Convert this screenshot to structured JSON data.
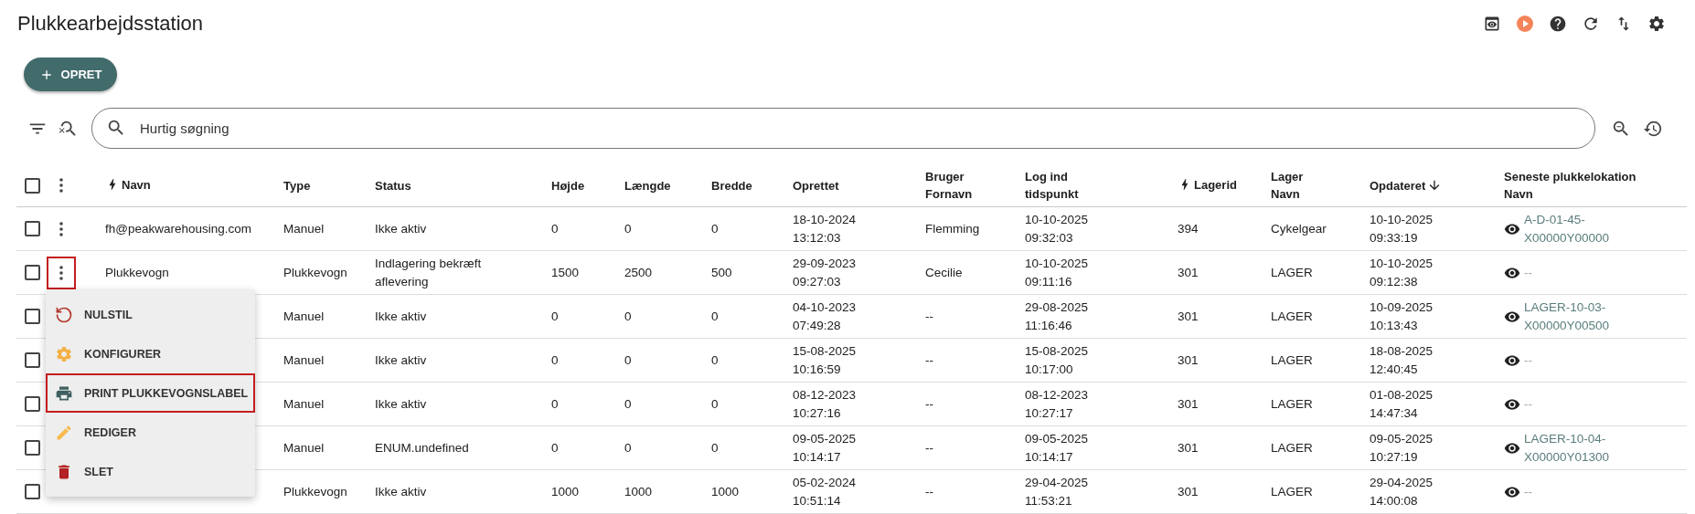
{
  "title": "Plukkearbejdsstation",
  "toolbar_icons": [
    {
      "kind": "preview"
    },
    {
      "kind": "play"
    },
    {
      "kind": "help"
    },
    {
      "kind": "refresh"
    },
    {
      "kind": "swap"
    },
    {
      "kind": "settings"
    }
  ],
  "create_button": {
    "label": "OPRET"
  },
  "search": {
    "placeholder": "Hurtig søgning"
  },
  "table": {
    "select_all": {
      "checked": false
    },
    "columns": [
      {
        "label": "Navn",
        "kind": "quick",
        "sorted": false
      },
      {
        "label": "Type",
        "kind": "plain",
        "sorted": false
      },
      {
        "label": "Status",
        "kind": "plain",
        "sorted": false
      },
      {
        "label": "Højde",
        "kind": "plain",
        "sorted": false
      },
      {
        "label": "Længde",
        "kind": "plain",
        "sorted": false
      },
      {
        "label": "Bredde",
        "kind": "plain",
        "sorted": false
      },
      {
        "label": "Oprettet",
        "kind": "plain",
        "sorted": false
      },
      {
        "label": "Bruger Fornavn",
        "kind": "plain",
        "sorted": false
      },
      {
        "label": "Log ind tidspunkt",
        "kind": "plain",
        "sorted": false
      },
      {
        "label": "Lagerid",
        "kind": "quick",
        "sorted": false
      },
      {
        "label": "Lager Navn",
        "kind": "plain",
        "sorted": false
      },
      {
        "label": "Opdateret",
        "kind": "plain",
        "sorted": true
      },
      {
        "label": "Seneste plukkelokation Navn",
        "kind": "plain",
        "sorted": false
      }
    ],
    "rows": [
      {
        "checked": false,
        "menu_button": {
          "outlined": false
        },
        "cells": [
          "fh@peakwarehousing.com",
          "Manuel",
          "Ikke aktiv",
          "0",
          "0",
          "0",
          "18-10-2024 13:12:03",
          "Flemming",
          "10-10-2025 09:32:03",
          "394",
          "Cykelgear",
          "10-10-2025 09:33:19"
        ],
        "location": {
          "text": "A-D-01-45-X00000Y00000",
          "linked": true
        }
      },
      {
        "checked": false,
        "menu_button": {
          "outlined": true
        },
        "cells": [
          "Plukkevogn",
          "Plukkevogn",
          "Indlagering bekræft aflevering",
          "1500",
          "2500",
          "500",
          "29-09-2023 09:27:03",
          "Cecilie",
          "10-10-2025 09:11:16",
          "301",
          "LAGER",
          "10-10-2025 09:12:38"
        ],
        "location": {
          "text": "--",
          "linked": false
        }
      },
      {
        "checked": false,
        "cells": [
          "",
          "Manuel",
          "Ikke aktiv",
          "0",
          "0",
          "0",
          "04-10-2023 07:49:28",
          "--",
          "29-08-2025 11:16:46",
          "301",
          "LAGER",
          "10-09-2025 10:13:43"
        ],
        "location": {
          "text": "LAGER-10-03-X00000Y00500",
          "linked": true
        }
      },
      {
        "checked": false,
        "cells": [
          "",
          "Manuel",
          "Ikke aktiv",
          "0",
          "0",
          "0",
          "15-08-2025 10:16:59",
          "--",
          "15-08-2025 10:17:00",
          "301",
          "LAGER",
          "18-08-2025 12:40:45"
        ],
        "location": {
          "text": "--",
          "linked": false
        }
      },
      {
        "checked": false,
        "cells": [
          "",
          "Manuel",
          "Ikke aktiv",
          "0",
          "0",
          "0",
          "08-12-2023 10:27:16",
          "--",
          "08-12-2023 10:27:17",
          "301",
          "LAGER",
          "01-08-2025 14:47:34"
        ],
        "location": {
          "text": "--",
          "linked": false
        }
      },
      {
        "checked": false,
        "cells": [
          "",
          "Manuel",
          "ENUM.undefined",
          "0",
          "0",
          "0",
          "09-05-2025 10:14:17",
          "--",
          "09-05-2025 10:14:17",
          "301",
          "LAGER",
          "09-05-2025 10:27:19"
        ],
        "location": {
          "text": "LAGER-10-04-X00000Y01300",
          "linked": true
        }
      },
      {
        "checked": false,
        "cells": [
          "",
          "Plukkevogn",
          "Ikke aktiv",
          "1000",
          "1000",
          "1000",
          "05-02-2024 10:51:14",
          "--",
          "29-04-2025 11:53:21",
          "301",
          "LAGER",
          "29-04-2025 14:00:08"
        ],
        "location": {
          "text": "--",
          "linked": false
        }
      }
    ]
  },
  "row_menu": {
    "items": [
      {
        "label": "NULSTIL",
        "kind": "reset",
        "outlined": false
      },
      {
        "label": "KONFIGURER",
        "kind": "configure",
        "outlined": false
      },
      {
        "label": "PRINT PLUKKEVOGNSLABEL",
        "kind": "print",
        "outlined": true
      },
      {
        "label": "REDIGER",
        "kind": "edit",
        "outlined": false
      },
      {
        "label": "SLET",
        "kind": "delete",
        "outlined": false
      }
    ]
  }
}
